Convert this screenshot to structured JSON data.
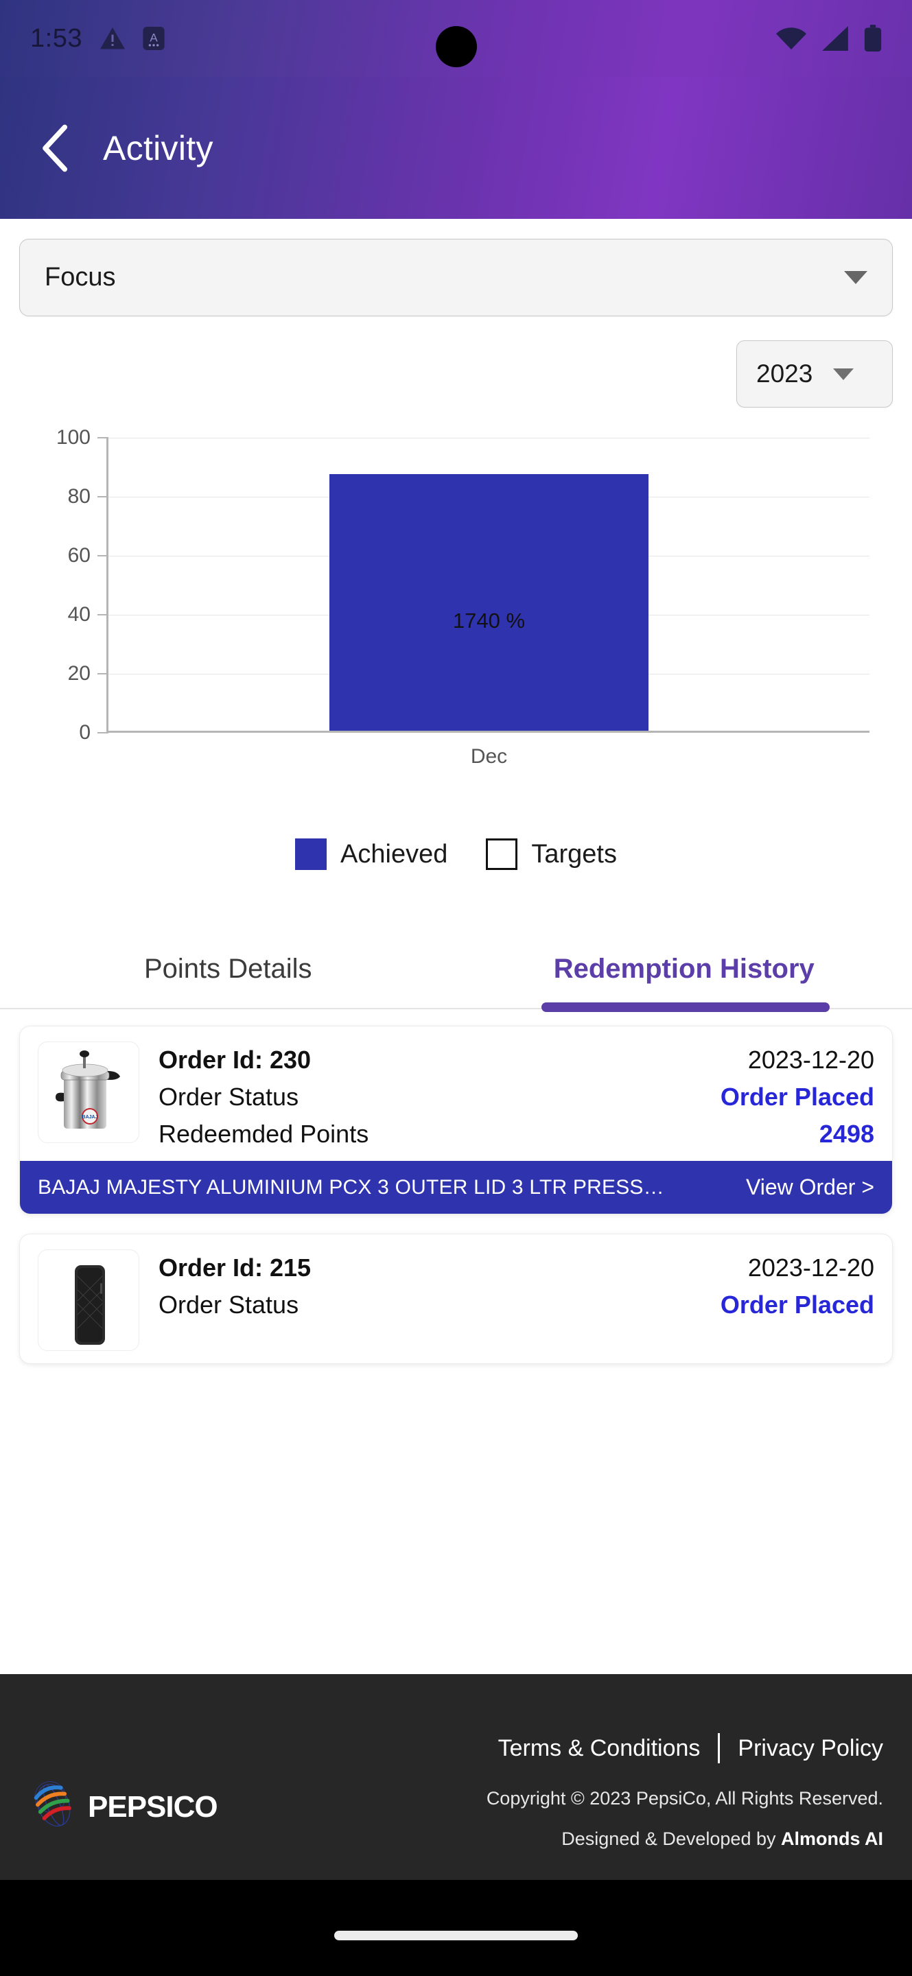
{
  "status_bar": {
    "time": "1:53",
    "icons_left": [
      "warning-triangle-icon",
      "font-size-icon"
    ],
    "icons_right": [
      "wifi-icon",
      "cellular-signal-icon",
      "battery-icon"
    ]
  },
  "header": {
    "back_icon": "chevron-left-icon",
    "title": "Activity",
    "gradient_start": "#2f3480",
    "gradient_end": "#8036c2"
  },
  "filters": {
    "focus": {
      "value": "Focus",
      "caret_icon": "chevron-down-icon"
    },
    "year": {
      "value": "2023",
      "caret_icon": "chevron-down-icon"
    }
  },
  "chart_data": {
    "type": "bar",
    "title": "",
    "xlabel": "",
    "ylabel": "",
    "categories": [
      "Dec"
    ],
    "values": [
      87
    ],
    "data_labels": [
      "1740 %"
    ],
    "ylim": [
      0,
      100
    ],
    "yticks": [
      100,
      80,
      60,
      40,
      20,
      0
    ],
    "grid": true,
    "legend_position": "bottom",
    "series": [
      {
        "name": "Achieved",
        "values": [
          87
        ],
        "color": "#2f33ad",
        "style": "filled"
      },
      {
        "name": "Targets",
        "values": [],
        "color": "#ffffff",
        "style": "outline"
      }
    ]
  },
  "legend": {
    "achieved_label": "Achieved",
    "targets_label": "Targets",
    "achieved_color": "#2f33ad",
    "targets_color": "#ffffff"
  },
  "tabs": [
    {
      "label": "Points Details",
      "active": false
    },
    {
      "label": "Redemption History",
      "active": true
    }
  ],
  "tab_accent_color": "#5b3ea8",
  "orders": [
    {
      "thumb_icon": "pressure-cooker-image",
      "order_id_label": "Order Id: 230",
      "date": "2023-12-20",
      "status_label": "Order Status",
      "status_value": "Order Placed",
      "points_label": "Redeemded Points",
      "points_value": "2498",
      "product_name": "BAJAJ MAJESTY ALUMINIUM PCX 3 OUTER LID 3 LTR PRESS…",
      "view_order_label": "View Order >"
    },
    {
      "thumb_icon": "power-bank-image",
      "order_id_label": "Order Id: 215",
      "date": "2023-12-20",
      "status_label": "Order Status",
      "status_value": "Order Placed",
      "points_label": "",
      "points_value": "",
      "product_name": "",
      "view_order_label": ""
    }
  ],
  "footer": {
    "terms_label": "Terms & Conditions",
    "privacy_label": "Privacy Policy",
    "brand": "PEPSICO",
    "brand_icon": "pepsico-globe-icon",
    "copyright": "Copyright © 2023 PepsiCo, All Rights Reserved.",
    "credit_prefix": "Designed & Developed by ",
    "credit_company": "Almonds AI",
    "background": "#272727"
  },
  "nav_bar": {
    "home_indicator": "home-indicator"
  }
}
